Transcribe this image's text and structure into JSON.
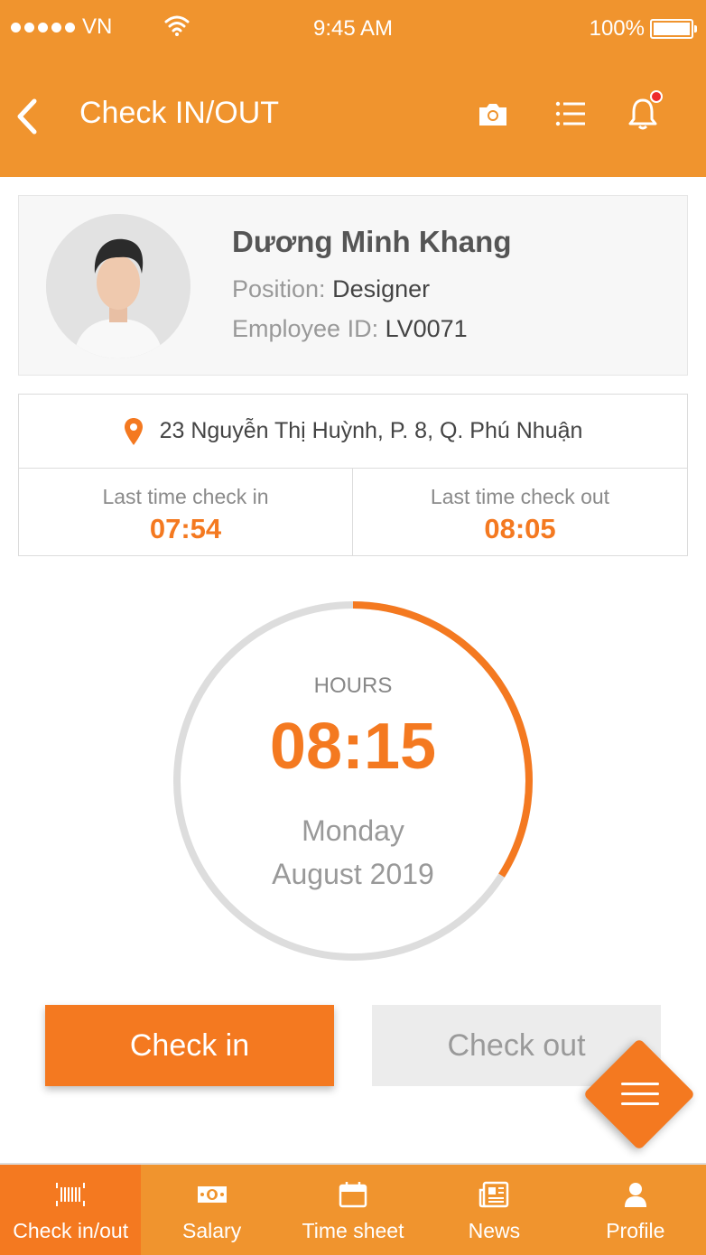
{
  "status_bar": {
    "carrier": "VN",
    "time": "9:45 AM",
    "battery": "100%"
  },
  "header": {
    "title": "Check IN/OUT",
    "icons": [
      "back-arrow-icon",
      "camera-icon",
      "list-icon",
      "bell-icon"
    ],
    "has_notification": true
  },
  "profile": {
    "name": "Dương Minh Khang",
    "position_label": "Position:",
    "position_value": "Designer",
    "employee_id_label": "Employee ID:",
    "employee_id_value": "LV0071"
  },
  "location": {
    "address": "23 Nguyễn Thị Huỳnh, P. 8, Q. Phú Nhuận",
    "last_check_in_label": "Last time check in",
    "last_check_in_value": "07:54",
    "last_check_out_label": "Last time check out",
    "last_check_out_value": "08:05"
  },
  "timer": {
    "label": "HOURS",
    "value": "08:15",
    "day": "Monday",
    "month_year": "August 2019",
    "progress_fraction": 0.34
  },
  "actions": {
    "check_in_label": "Check in",
    "check_out_label": "Check out"
  },
  "bottom_nav": {
    "items": [
      {
        "label": "Check in/out",
        "icon": "barcode-icon",
        "active": true
      },
      {
        "label": "Salary",
        "icon": "money-icon",
        "active": false
      },
      {
        "label": "Time sheet",
        "icon": "calendar-icon",
        "active": false
      },
      {
        "label": "News",
        "icon": "newspaper-icon",
        "active": false
      },
      {
        "label": "Profile",
        "icon": "person-icon",
        "active": false
      }
    ]
  },
  "colors": {
    "brand_orange": "#f0942e",
    "accent_orange": "#f47920",
    "ring_track": "#dddddd",
    "notification_red": "#ee2b2b"
  }
}
